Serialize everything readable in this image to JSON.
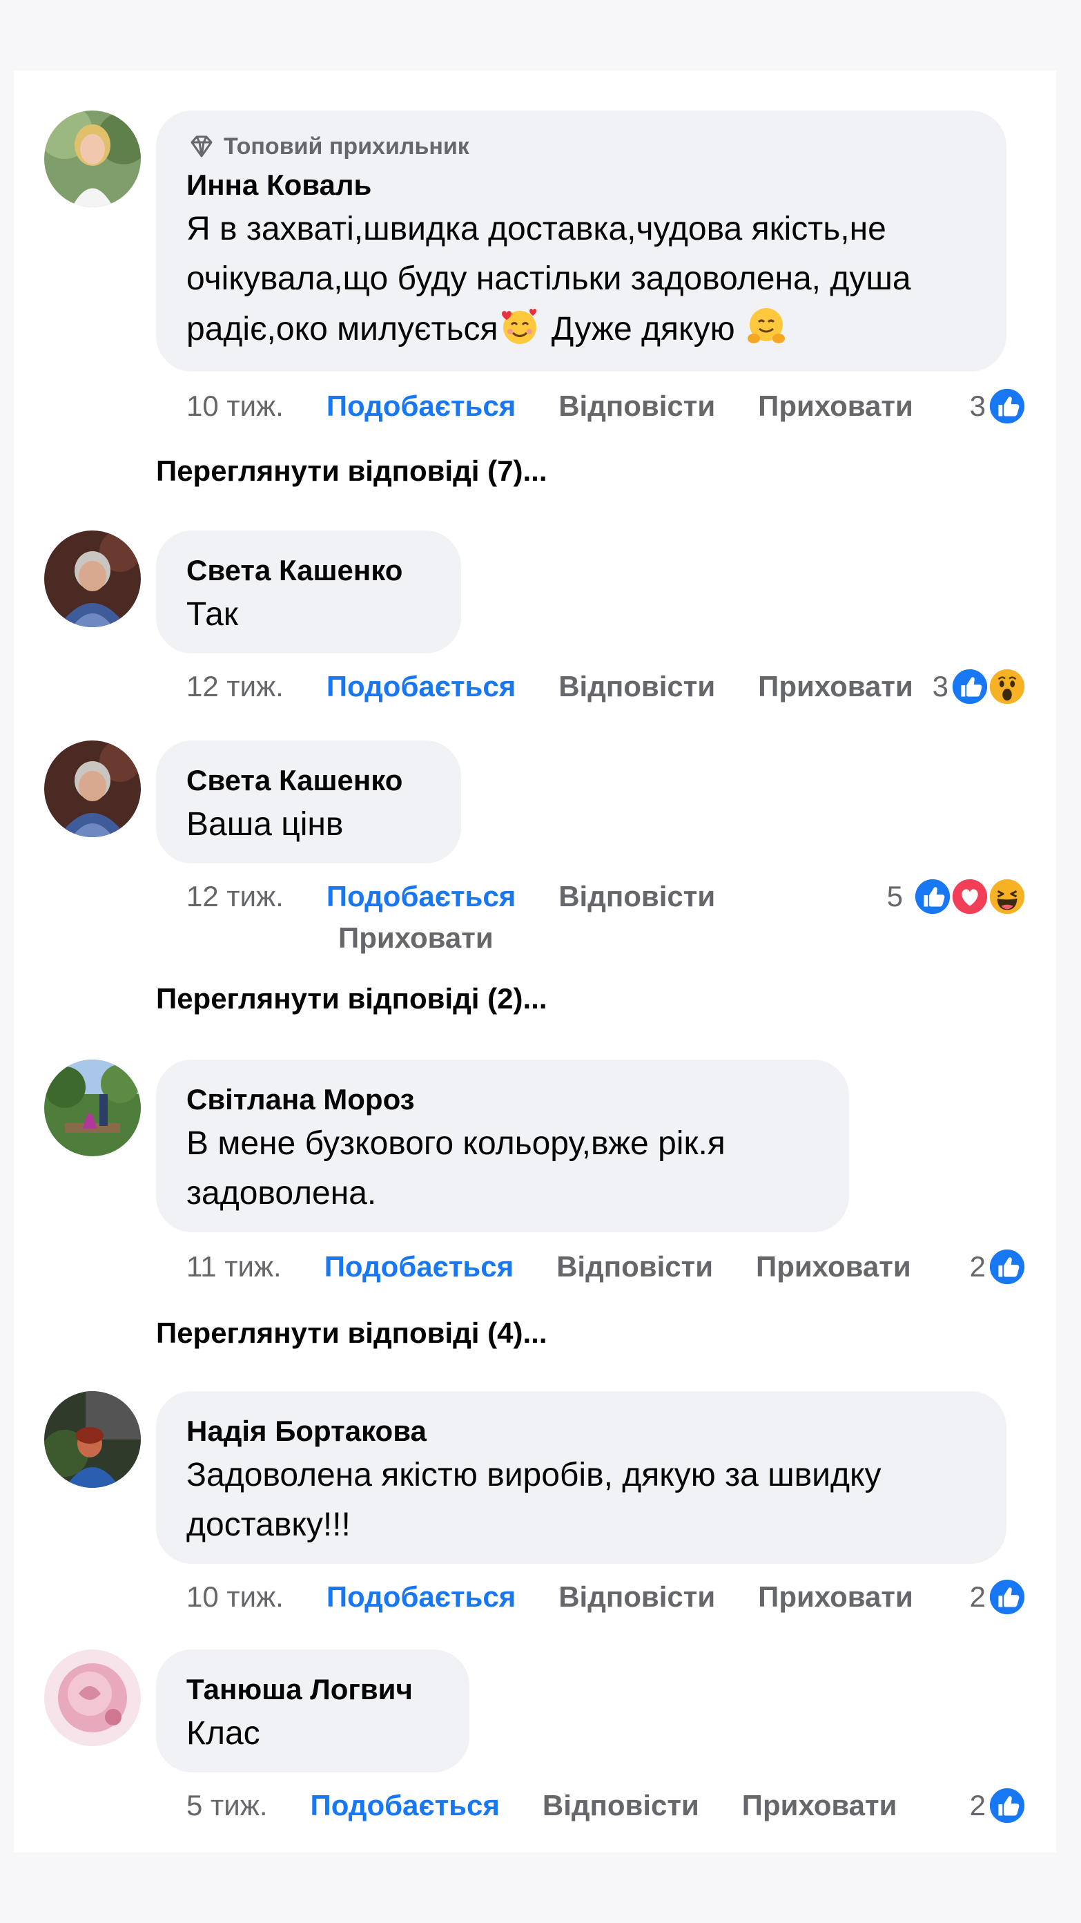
{
  "comments": [
    {
      "badge": "Топовий прихильник",
      "author": "Инна Коваль",
      "text_a": "Я в захваті,швидка доставка,чудова якість,не очікувала,що буду настільки задоволена, душа радіє,око милується",
      "text_b": " Дуже дякую ",
      "time": "10 тиж.",
      "like": "Подобається",
      "reply": "Відповісти",
      "hide": "Приховати",
      "reaction_count": "3",
      "reactions": [
        "like"
      ],
      "view_replies": "Переглянути відповіді (7)..."
    },
    {
      "author": "Света Кашенко",
      "text": "Так",
      "time": "12 тиж.",
      "like": "Подобається",
      "reply": "Відповісти",
      "hide": "Приховати",
      "reaction_count": "3",
      "reactions": [
        "like",
        "wow"
      ]
    },
    {
      "author": "Света Кашенко",
      "text": "Ваша цінв",
      "time": "12 тиж.",
      "like": "Подобається",
      "reply": "Відповісти",
      "hide": "Приховати",
      "reaction_count": "5",
      "reactions": [
        "like",
        "love",
        "haha"
      ],
      "view_replies": "Переглянути відповіді (2)..."
    },
    {
      "author": "Світлана Мороз",
      "text": "В мене бузкового кольору,вже рік.я задоволена.",
      "time": "11 тиж.",
      "like": "Подобається",
      "reply": "Відповісти",
      "hide": "Приховати",
      "reaction_count": "2",
      "reactions": [
        "like"
      ],
      "view_replies": "Переглянути відповіді (4)..."
    },
    {
      "author": "Надія Бортакова",
      "text": "Задоволена якістю виробів, дякую за швидку доставку!!!",
      "time": "10 тиж.",
      "like": "Подобається",
      "reply": "Відповісти",
      "hide": "Приховати",
      "reaction_count": "2",
      "reactions": [
        "like"
      ]
    },
    {
      "author": "Танюша Логвич",
      "text": "Клас",
      "time": "5 тиж.",
      "like": "Подобається",
      "reply": "Відповісти",
      "hide": "Приховати",
      "reaction_count": "2",
      "reactions": [
        "like"
      ]
    }
  ],
  "colors": {
    "like_blue": "#1877f2",
    "meta_gray": "#65676b",
    "bubble_bg": "#f0f2f5",
    "love_red": "#f33e58"
  }
}
